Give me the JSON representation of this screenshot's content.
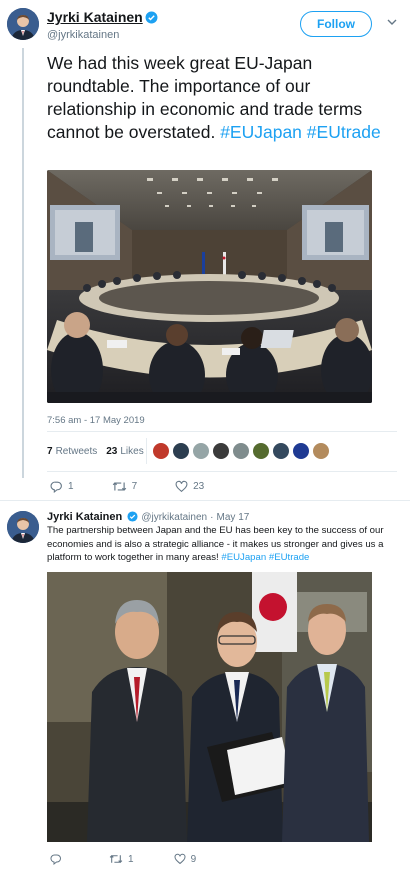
{
  "tweet": {
    "author_name": "Jyrki Katainen",
    "author_handle": "@jyrkikatainen",
    "follow_label": "Follow",
    "text_main": "We had this week great EU-Japan roundtable. The importance of our relationship in economic and trade terms cannot be overstated.",
    "hashtag1": "#EUJapan",
    "hashtag2": "#EUtrade",
    "timestamp": "7:56 am - 17 May 2019",
    "retweets_count": "7",
    "retweets_label": "Retweets",
    "likes_count": "23",
    "likes_label": "Likes",
    "reply_count": "1",
    "retweet_action_count": "7",
    "like_action_count": "23"
  },
  "reply": {
    "author_name": "Jyrki Katainen",
    "author_handle": "@jyrkikatainen",
    "separator": "·",
    "date": "May 17",
    "text": "The partnership between Japan and the EU has been key to the success of our economies and is also a strategic alliance - it makes us stronger and gives us a platform to work together in many areas!",
    "hashtag1": "#EUJapan",
    "hashtag2": "#EUtrade",
    "reply_count": "",
    "retweet_count": "1",
    "like_count": "9"
  },
  "colors": {
    "accent": "#1da1f2",
    "text": "#14171a",
    "muted": "#657786",
    "divider": "#e6ecf0"
  }
}
